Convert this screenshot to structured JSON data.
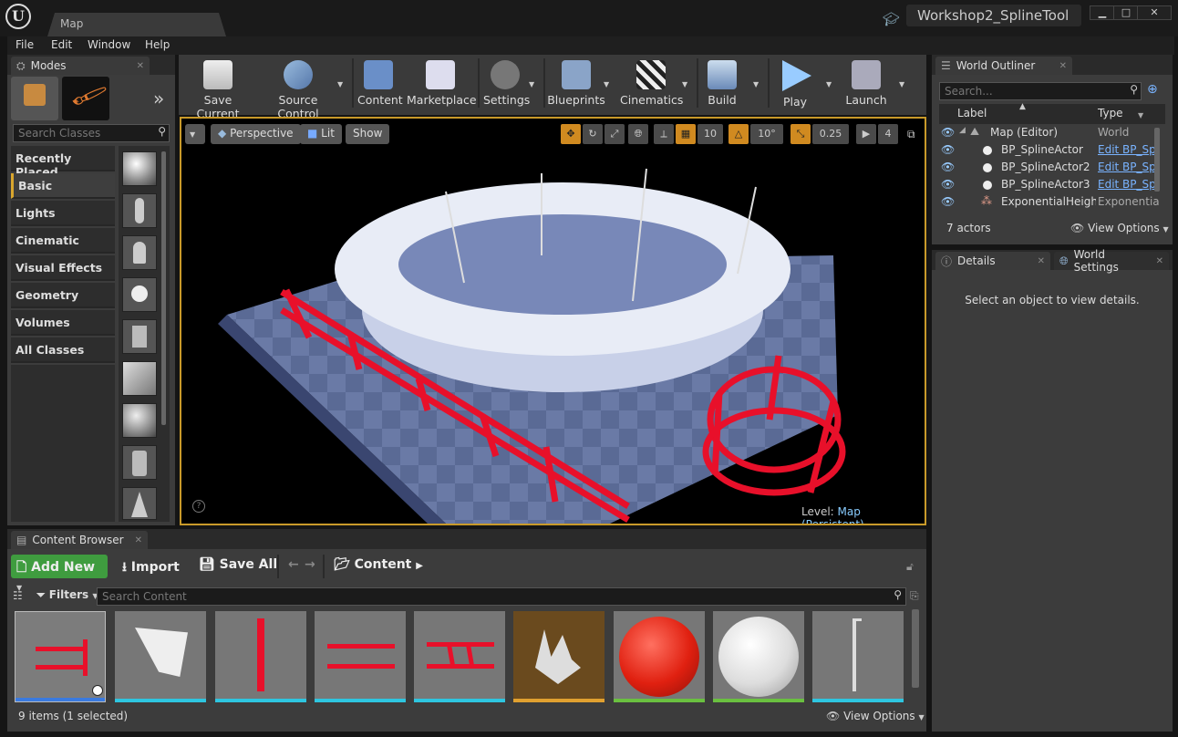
{
  "app": {
    "map_tab": "Map",
    "project": "Workshop2_SplineTool"
  },
  "menu": [
    "File",
    "Edit",
    "Window",
    "Help"
  ],
  "modes": {
    "tab": "Modes",
    "search_placeholder": "Search Classes",
    "categories": [
      "Recently Placed",
      "Basic",
      "Lights",
      "Cinematic",
      "Visual Effects",
      "Geometry",
      "Volumes",
      "All Classes"
    ],
    "selected_category": "Basic"
  },
  "toolbar": [
    "Save Current",
    "Source Control",
    "Content",
    "Marketplace",
    "Settings",
    "Blueprints",
    "Cinematics",
    "Build",
    "Play",
    "Launch"
  ],
  "viewport": {
    "perspective": "Perspective",
    "lit": "Lit",
    "show": "Show",
    "grid_snap": "10",
    "rotation_snap": "10°",
    "scale_snap": "0.25",
    "camera_speed": "4",
    "level_label": "Level:",
    "level_value": "Map (Persistent)"
  },
  "outliner": {
    "tab": "World Outliner",
    "search_placeholder": "Search...",
    "col_label": "Label",
    "col_type": "Type",
    "rows": [
      {
        "label": "Map (Editor)",
        "type": "World"
      },
      {
        "label": "BP_SplineActor",
        "type": "Edit BP_Sp"
      },
      {
        "label": "BP_SplineActor2",
        "type": "Edit BP_Sp"
      },
      {
        "label": "BP_SplineActor3",
        "type": "Edit BP_Sp"
      },
      {
        "label": "ExponentialHeightF",
        "type": "Exponentia"
      }
    ],
    "count": "7 actors",
    "view_options": "View Options"
  },
  "details": {
    "tab": "Details",
    "tab2": "World Settings",
    "empty": "Select an object to view details."
  },
  "content_browser": {
    "tab": "Content Browser",
    "add_new": "Add New",
    "import": "Import",
    "save_all": "Save All",
    "path": "Content",
    "filters": "Filters",
    "search_placeholder": "Search Content",
    "status": "9 items (1 selected)",
    "view_options": "View Options",
    "thumb_colors": [
      "#3a7ae0",
      "#2ec6e0",
      "#2ec6e0",
      "#2ec6e0",
      "#2ec6e0",
      "#e0a030",
      "#6ac040",
      "#6ac040",
      "#2ec6e0"
    ]
  },
  "colors": {
    "accent": "#c99a2a",
    "add_new": "#3f9c3f",
    "link": "#79b3ff"
  }
}
